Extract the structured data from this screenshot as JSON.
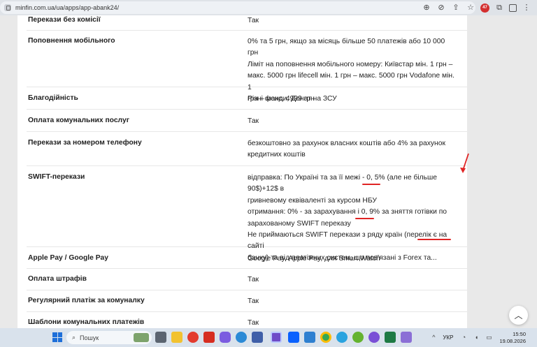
{
  "browser": {
    "url": "minfin.com.ua/ua/apps/app-abank24/",
    "icons": [
      "zoom-icon",
      "eye-off-icon",
      "share-icon",
      "star-icon",
      "extension-icon",
      "puzzle-icon",
      "profile-icon",
      "menu-icon"
    ],
    "extension_badge": "47"
  },
  "table": {
    "rows": [
      {
        "key": "Перекази без комісії",
        "value": [
          "Так"
        ]
      },
      {
        "key": "Поповнення мобільного",
        "value": [
          "0% та 5 грн, якщо за місяць більше 50 платежів або 10 000 грн",
          "Ліміт на поповнення мобільного номеру: Київстар мін. 1 грн –",
          "макс. 5000 грн lifecell мін. 1 грн – макс. 5000 грн Vodafone мін. 1",
          "грн – макс. 4999 грн"
        ]
      },
      {
        "key": "Благодійність",
        "value": [
          "Різні фонди, Донат на ЗСУ"
        ]
      },
      {
        "key": "Оплата комунальних послуг",
        "value": [
          "Так"
        ]
      },
      {
        "key": "Перекази за номером телефону",
        "value": [
          "безкоштовно за рахунок власних коштів або 4% за рахунок",
          "кредитних коштів"
        ]
      },
      {
        "key": "SWIFT-перекази",
        "value": [
          "відправка: По Україні та за її межі - 0, 5% (але не більше 90$)+12$ в",
          "гривневому еквіваленті за курсом НБУ",
          "отримання: 0% - за зарахування і 0, 9% за зняття готівки по",
          "зарахованому SWIFT переказу",
          "Не приймаються SWIFT перекази з ряду країн (перелік є на сайті",
          "банку) та від платіжних систем, що пов'язані з Forex та..."
        ]
      },
      {
        "key": "Apple Pay / Google Pay",
        "value": [
          "Google Pay, Apple Pay, для Smart Watch"
        ]
      },
      {
        "key": "Оплата штрафів",
        "value": [
          "Так"
        ]
      },
      {
        "key": "Регулярний платіж за комуналку",
        "value": [
          "Так"
        ]
      },
      {
        "key": "Шаблони комунальних платежів",
        "value": [
          "Так"
        ]
      }
    ]
  },
  "annotation_color": "#e02424",
  "taskbar": {
    "search_placeholder": "Пошук",
    "language": "УКР",
    "time": "15:50",
    "date": "19.08.2026",
    "app_icons": [
      "file-explorer-icon",
      "settings-icon",
      "opera-icon",
      "l-app-icon",
      "copilot-icon",
      "edge-icon",
      "store-icon",
      "snipping-icon",
      "dropbox-icon",
      "photos-icon",
      "chrome-icon",
      "telegram-icon",
      "utorrent-icon",
      "media-icon",
      "viber-icon",
      "excel-icon",
      "notes-icon"
    ]
  }
}
